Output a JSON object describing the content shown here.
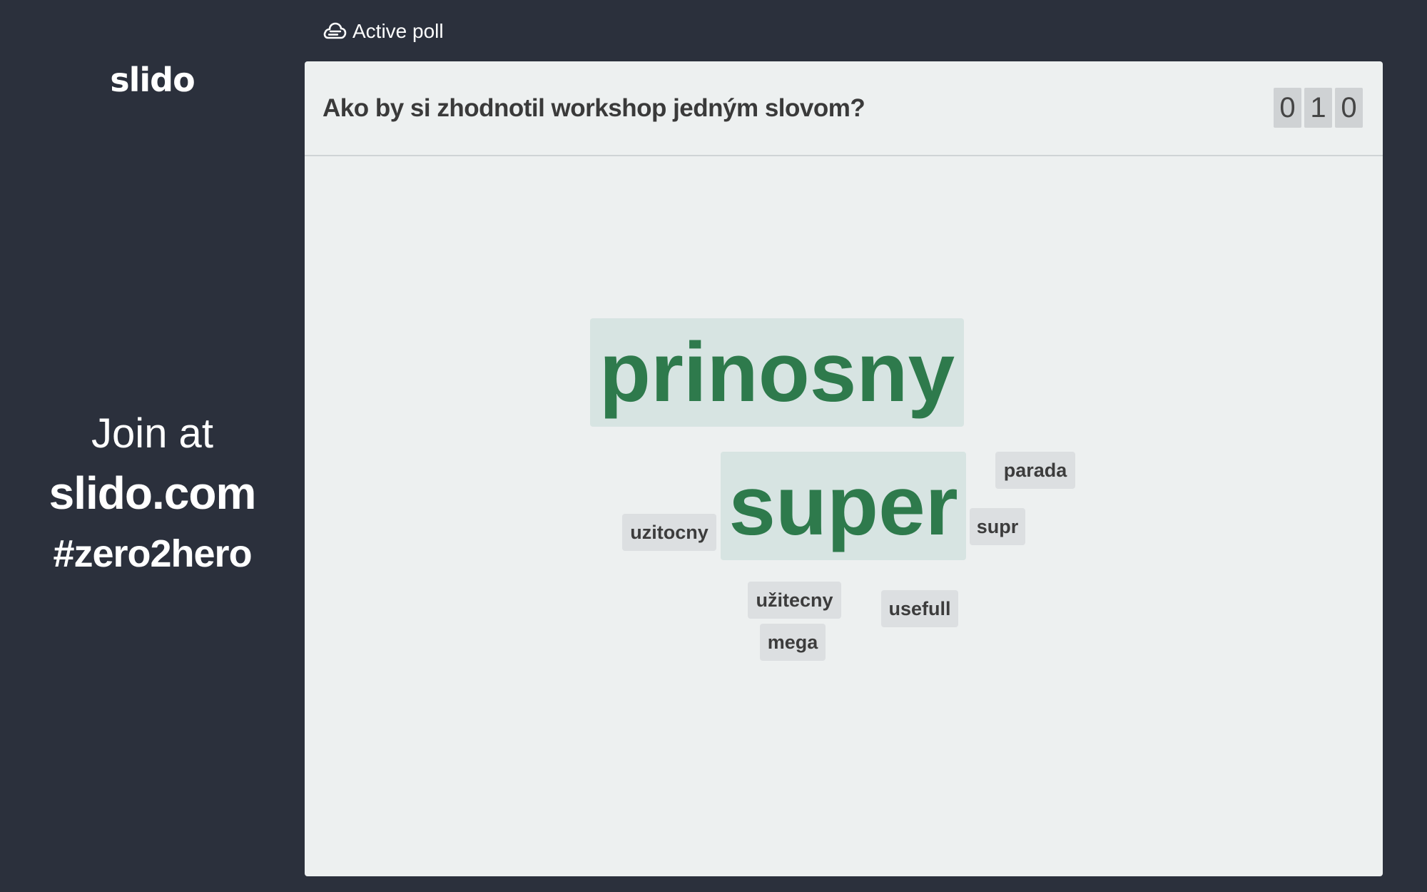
{
  "brand": {
    "logo": "slido"
  },
  "join": {
    "label": "Join at",
    "url": "slido.com",
    "code": "#zero2hero"
  },
  "status": {
    "label": "Active poll",
    "icon": "poll-cloud-icon"
  },
  "poll": {
    "question": "Ako by si zhodnotil workshop jedným slovom?",
    "participant_count_digits": [
      "0",
      "1",
      "0"
    ]
  },
  "word_cloud": {
    "accent_color": "#2e7a4c",
    "words": [
      {
        "text": "prinosny",
        "emphasis": "large"
      },
      {
        "text": "super",
        "emphasis": "large"
      },
      {
        "text": "parada",
        "emphasis": "small"
      },
      {
        "text": "uzitocny",
        "emphasis": "small"
      },
      {
        "text": "supr",
        "emphasis": "small"
      },
      {
        "text": "užitecny",
        "emphasis": "small"
      },
      {
        "text": "usefull",
        "emphasis": "small"
      },
      {
        "text": "mega",
        "emphasis": "small"
      }
    ]
  }
}
